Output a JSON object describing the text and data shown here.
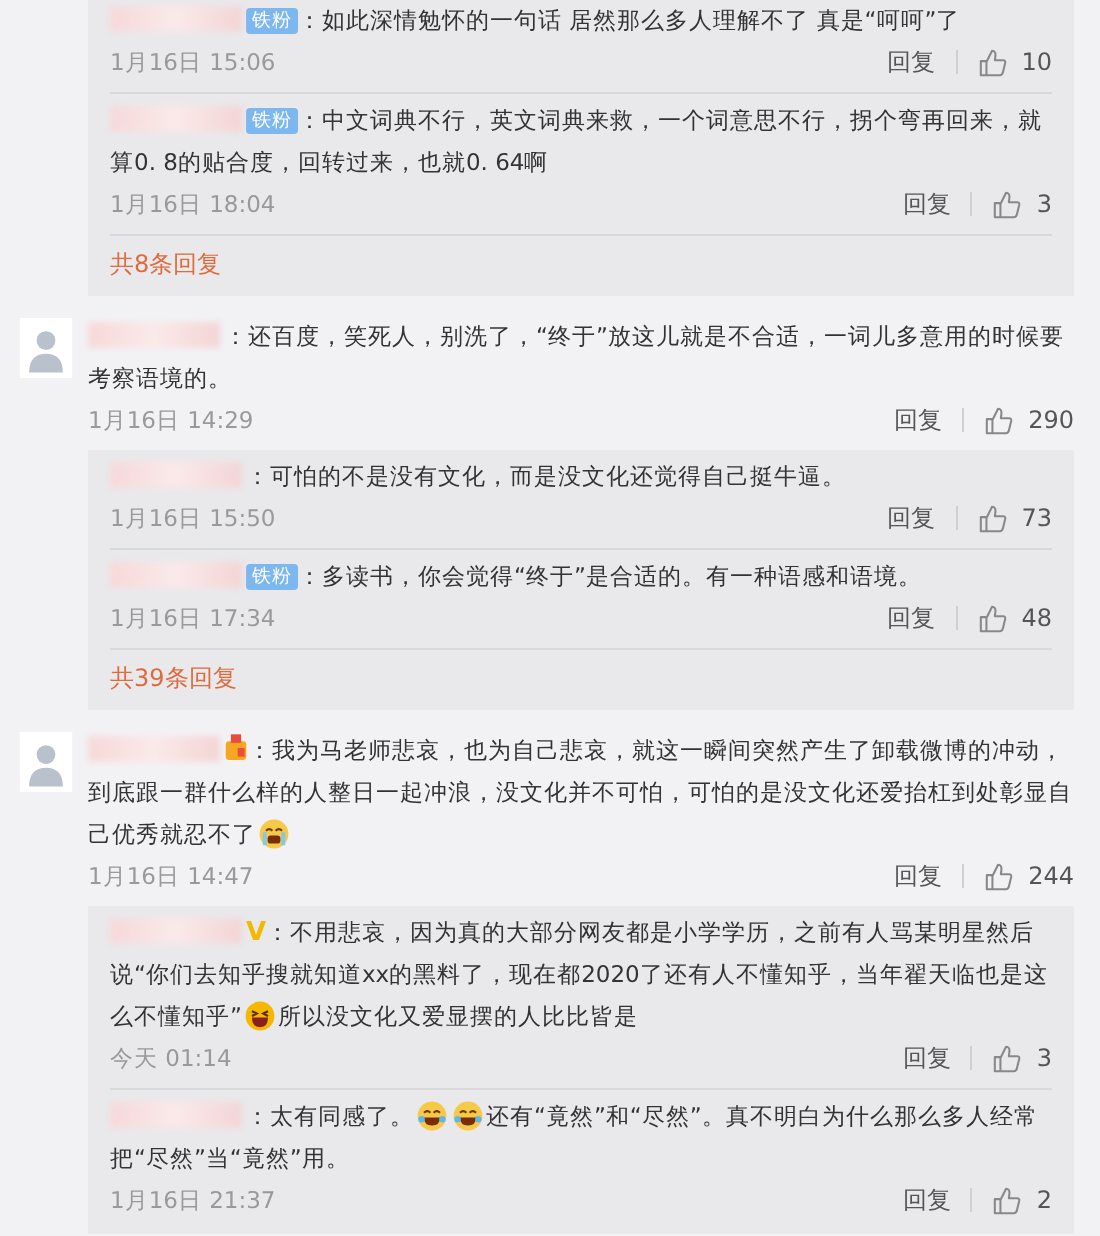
{
  "threads": [
    {
      "replies": [
        {
          "badges": [
            {
              "kind": "fan",
              "text": "铁粉"
            }
          ],
          "content": [
            {
              "kind": "text",
              "text": "：如此深情勉怀的一句话 居然那么多人理解不了 真是“呵呵”了"
            }
          ],
          "time": "1月16日 15:06",
          "reply": "回复",
          "likes": "10"
        },
        {
          "badges": [
            {
              "kind": "fan",
              "text": "铁粉"
            }
          ],
          "content": [
            {
              "kind": "text",
              "text": "：中文词典不行，英文词典来救，一个词意思不行，拐个弯再回来，就算0. 8的贴合度，回转过来，也就0. 64啊"
            }
          ],
          "time": "1月16日 18:04",
          "reply": "回复",
          "likes": "3"
        }
      ],
      "more": "共8条回复"
    },
    {
      "comment": {
        "content": [
          {
            "kind": "text",
            "text": "：还百度，笑死人，别洗了，“终于”放这儿就是不合适，一词儿多意用的时候要考察语境的。"
          }
        ],
        "time": "1月16日 14:29",
        "reply": "回复",
        "likes": "290"
      },
      "replies": [
        {
          "content": [
            {
              "kind": "text",
              "text": "：可怕的不是没有文化，而是没文化还觉得自己挺牛逼。"
            }
          ],
          "time": "1月16日 15:50",
          "reply": "回复",
          "likes": "73"
        },
        {
          "badges": [
            {
              "kind": "fan",
              "text": "铁粉"
            }
          ],
          "content": [
            {
              "kind": "text",
              "text": "：多读书，你会觉得“终于”是合适的。有一种语感和语境。"
            }
          ],
          "time": "1月16日 17:34",
          "reply": "回复",
          "likes": "48"
        }
      ],
      "more": "共39条回复"
    },
    {
      "comment": {
        "badges": [
          {
            "kind": "medal"
          }
        ],
        "content": [
          {
            "kind": "text",
            "text": "：我为马老师悲哀，也为自己悲哀，就这一瞬间突然产生了卸载微博的冲动，到底跟一群什么样的人整日一起冲浪，没文化并不可怕，可怕的是没文化还爱抬杠到处彰显自己优秀就忍不了"
          },
          {
            "kind": "crying"
          }
        ],
        "time": "1月16日 14:47",
        "reply": "回复",
        "likes": "244"
      },
      "replies": [
        {
          "badges": [
            {
              "kind": "vip",
              "text": "V"
            }
          ],
          "content": [
            {
              "kind": "text",
              "text": "：不用悲哀，因为真的大部分网友都是小学学历，之前有人骂某明星然后说“你们去知乎搜就知道xx的黑料了，现在都2020了还有人不懂知乎，当年翟天临也是这么不懂知乎”"
            },
            {
              "kind": "grin"
            },
            {
              "kind": "text",
              "text": "所以没文化又爱显摆的人比比皆是"
            }
          ],
          "time": "今天 01:14",
          "reply": "回复",
          "likes": "3"
        },
        {
          "content": [
            {
              "kind": "text",
              "text": "：太有同感了。"
            },
            {
              "kind": "laughing"
            },
            {
              "kind": "laughing"
            },
            {
              "kind": "text",
              "text": "还有“竟然”和“尽然”。真不明白为什么那么多人经常把“尽然”当“竟然”用。"
            }
          ],
          "time": "1月16日 21:37",
          "reply": "回复",
          "likes": "2"
        }
      ]
    }
  ]
}
